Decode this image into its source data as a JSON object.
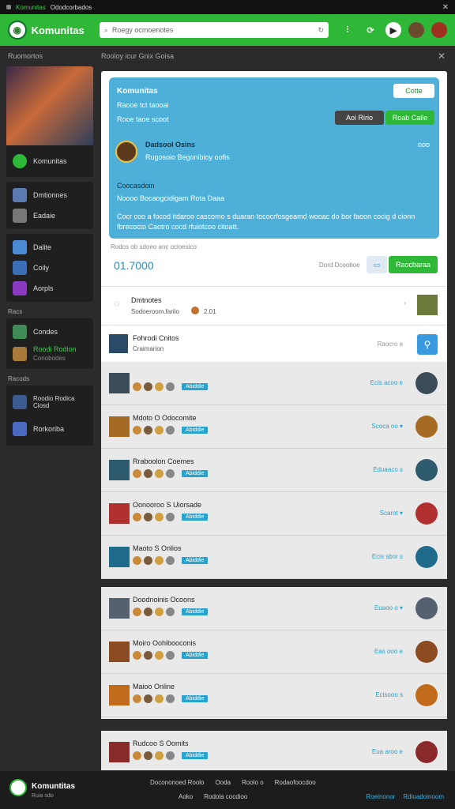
{
  "topbar": {
    "app": "Komunitas",
    "title": "Ododcorbados"
  },
  "header": {
    "title": "Komunitas",
    "search_placeholder": "Roegy ocmoenotes"
  },
  "subheader": {
    "left": "Ruomortos",
    "right": "Rooloy icur Gnix Goisa"
  },
  "sidebar": {
    "profile_label": "Komunitas",
    "group1": [
      {
        "label": "Dmtionnes"
      },
      {
        "label": "Eadaie"
      }
    ],
    "group2": [
      {
        "label": "Dalite"
      },
      {
        "label": "Coily"
      },
      {
        "label": "Aorpls"
      }
    ],
    "section_a": "Racs",
    "group3": [
      {
        "label": "Condes"
      },
      {
        "label": "Roodi Rodion",
        "sub": "Conobodes"
      }
    ],
    "section_b": "Racods",
    "group4": [
      {
        "label": "Roodio Rodica Ciosd"
      },
      {
        "label": "Rorkoriba"
      }
    ]
  },
  "card": {
    "title": "Komunitas",
    "line1": "Raooe tct taooai",
    "line2": "Rooe taoe scoot",
    "follow": "Cotte",
    "btn_dark": "Aoi Ririo",
    "btn_green": "Roab Calie",
    "user": "Dadsool Osins",
    "user_sub": "Rugosoio Begonibioy oofis",
    "more": "ooo",
    "note": "Coocasdoin",
    "note2": "Noooo Bocaogcidigam Rota Daaa",
    "desc": "Cocr coo a focod itdaroo cascomo s duaran tococrfosgeamd wooac do bor faoon cocig d cionn fbrecocto Caotro cocd rfuiotcoo citoatt."
  },
  "statsbar": {
    "caption": "Rodos ob sdoeo anc ocioesico",
    "value": "01.7000",
    "label": "Dord Dcooboe",
    "action": "Raocbaraa"
  },
  "info": [
    {
      "title": "Dmtnotes",
      "sub": "Sodoeroom.fariio",
      "value": "2.01"
    },
    {
      "title": "Fohrodi Cnitos",
      "sub": "Craimarion",
      "stat": "Raocro a"
    }
  ],
  "list1": [
    {
      "name": "",
      "stat": "Ecis acoo e",
      "avc": "#3a4c58",
      "tag": "Abiddie"
    },
    {
      "name": "Mdoto O Odocomite",
      "stat": "Scoca oo ▾",
      "avc": "#a56a23",
      "tag": "Abiddie"
    },
    {
      "name": "Rraboolon Coemes",
      "stat": "Eduaaco s",
      "avc": "#2f5b6f",
      "tag": "Abiddie"
    },
    {
      "name": "Oonooroo S Uiorsade",
      "stat": "Scarot ▾",
      "avc": "#b03030",
      "tag": "Abiddie"
    },
    {
      "name": "Maoto S Onlios",
      "stat": "Ecis sbor s",
      "avc": "#1e6b8b",
      "tag": "Abiddie"
    }
  ],
  "list2": [
    {
      "name": "Doodnoinis Ocoons",
      "stat": "Euaoo o ▾",
      "avc": "#556070",
      "tag": "Abiddie"
    },
    {
      "name": "Moiro Oohibooconis",
      "stat": "Eas ooo e",
      "avc": "#8b4a1f",
      "tag": "Abiddie"
    },
    {
      "name": "Maioo Online",
      "stat": "Ecisooo s",
      "avc": "#c06a1a",
      "tag": "Abiddie"
    }
  ],
  "list3": [
    {
      "name": "Rudcoo S Oomits",
      "stat": "Eua aroo e",
      "avc": "#8b2a2a",
      "tag": "Abiddie"
    }
  ],
  "footer": {
    "title": "Komuntitas",
    "sub": "Ruia sdo",
    "links": [
      "Docononoed Roolo",
      "Ooda",
      "Roolo o",
      "Rodaofoocdoo"
    ],
    "links2": [
      "Aoko",
      "Rodola cocdioo"
    ],
    "right1": "Roeinonor",
    "right2": "Rdioadoinoom"
  }
}
